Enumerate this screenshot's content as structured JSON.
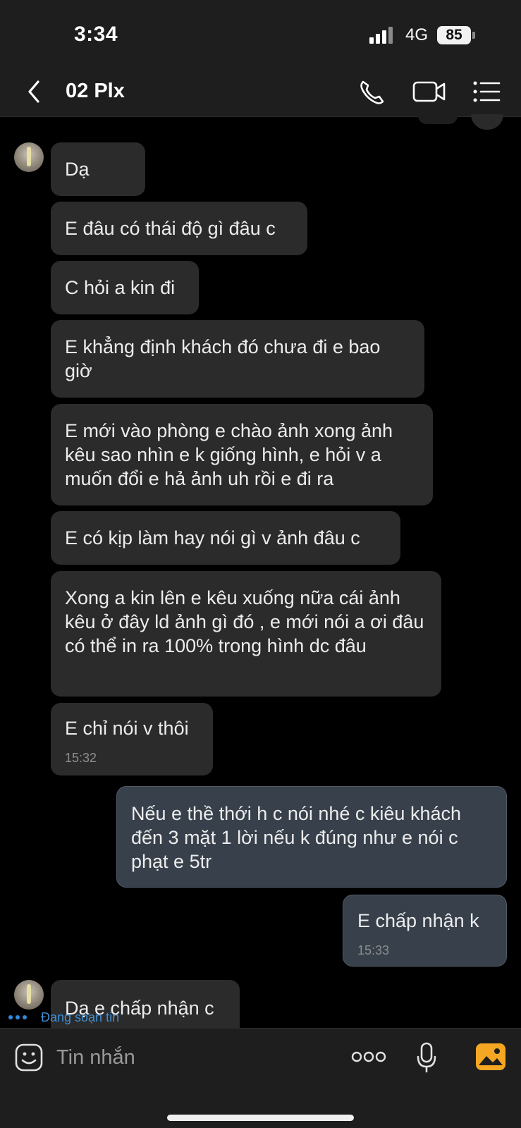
{
  "status_bar": {
    "time": "3:34",
    "network": "4G",
    "battery": "85"
  },
  "header": {
    "title": "02 Plx",
    "icons": [
      "chevron-left-icon",
      "phone-icon",
      "video-camera-icon",
      "list-menu-icon"
    ]
  },
  "messages": [
    {
      "direction": "in",
      "text": "Dạ"
    },
    {
      "direction": "in",
      "text": "E đâu có thái độ gì đâu c"
    },
    {
      "direction": "in",
      "text": "C hỏi a kin đi"
    },
    {
      "direction": "in",
      "text": "E khẳng định khách đó chưa đi e bao giờ"
    },
    {
      "direction": "in",
      "text": "E mới vào phòng e chào ảnh xong ảnh kêu sao nhìn e k giống hình, e hỏi v a muốn đổi e hả ảnh uh rồi e đi ra"
    },
    {
      "direction": "in",
      "text": "E có kịp làm hay nói gì v ảnh đâu c"
    },
    {
      "direction": "in",
      "text": "Xong a kin lên e kêu xuống nữa cái ảnh kêu ở đây ld ảnh gì đó , e mới nói a ơi đâu có thể in ra 100% trong hình dc đâu"
    },
    {
      "direction": "in",
      "text": "E chỉ nói v thôi",
      "time": "15:32"
    },
    {
      "direction": "out",
      "text": "Nếu e thề thới h c nói nhé c kiêu khách đến 3 mặt 1 lời nếu k đúng như e nói c phạt e 5tr"
    },
    {
      "direction": "out",
      "text": "E chấp nhận k",
      "time": "15:33"
    },
    {
      "direction": "in",
      "text": "Dạ e chấp nhận c"
    }
  ],
  "typing_indicator": "Đang soạn tin",
  "composer": {
    "placeholder": "Tin nhắn",
    "icons": [
      "sticker-emoji-icon",
      "more-options-icon",
      "microphone-icon",
      "gallery-image-icon"
    ],
    "gallery_color": "#f5a623"
  }
}
